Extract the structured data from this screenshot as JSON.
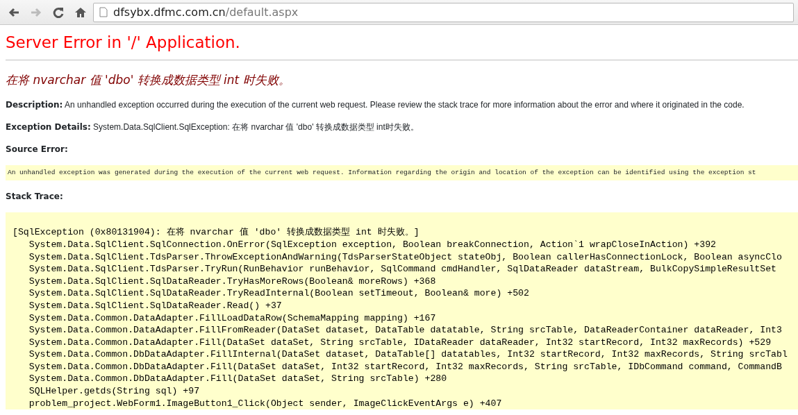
{
  "browser": {
    "nav_buttons": [
      {
        "kind": "back",
        "disabled": false
      },
      {
        "kind": "forward",
        "disabled": true
      },
      {
        "kind": "reload",
        "disabled": false
      },
      {
        "kind": "home",
        "disabled": false
      }
    ],
    "address": {
      "host": "dfsybx.dfmc.com.cn",
      "path": "/default.aspx"
    }
  },
  "page": {
    "title": "Server Error in '/' Application.",
    "error_message": "在将 nvarchar 值 'dbo' 转换成数据类型 int 时失败。",
    "description": "**Description:** An unhandled exception occurred during the execution of the current web request. Please review the stack trace for more information about the error and where it originated in the code.",
    "exception_details": "**Exception Details:** System.Data.SqlClient.SqlException: 在将 nvarchar 值 'dbo' 转换成数据类型 int时失败。",
    "source_error_heading": "Source Error:",
    "source_error_text": "An unhandled exception was generated during the execution of the current web request. Information regarding the origin and location of the exception can be identified using the exception st",
    "stack_trace_heading": "Stack Trace:",
    "stack_trace": [
      "[SqlException (0x80131904): 在将 nvarchar 值 'dbo' 转换成数据类型 int 时失败。]",
      "   System.Data.SqlClient.SqlConnection.OnError(SqlException exception, Boolean breakConnection, Action`1 wrapCloseInAction) +392",
      "   System.Data.SqlClient.TdsParser.ThrowExceptionAndWarning(TdsParserStateObject stateObj, Boolean callerHasConnectionLock, Boolean asyncClo",
      "   System.Data.SqlClient.TdsParser.TryRun(RunBehavior runBehavior, SqlCommand cmdHandler, SqlDataReader dataStream, BulkCopySimpleResultSet",
      "   System.Data.SqlClient.SqlDataReader.TryHasMoreRows(Boolean& moreRows) +368",
      "   System.Data.SqlClient.SqlDataReader.TryReadInternal(Boolean setTimeout, Boolean& more) +502",
      "   System.Data.SqlClient.SqlDataReader.Read() +37",
      "   System.Data.Common.DataAdapter.FillLoadDataRow(SchemaMapping mapping) +167",
      "   System.Data.Common.DataAdapter.FillFromReader(DataSet dataset, DataTable datatable, String srcTable, DataReaderContainer dataReader, Int3",
      "   System.Data.Common.DataAdapter.Fill(DataSet dataSet, String srcTable, IDataReader dataReader, Int32 startRecord, Int32 maxRecords) +529",
      "   System.Data.Common.DbDataAdapter.FillInternal(DataSet dataset, DataTable[] datatables, Int32 startRecord, Int32 maxRecords, String srcTabl",
      "   System.Data.Common.DbDataAdapter.Fill(DataSet dataSet, Int32 startRecord, Int32 maxRecords, String srcTable, IDbCommand command, CommandB",
      "   System.Data.Common.DbDataAdapter.Fill(DataSet dataSet, String srcTable) +280",
      "   SQLHelper.getds(String sql) +97",
      "   problem_project.WebForm1.ImageButton1_Click(Object sender, ImageClickEventArgs e) +407"
    ]
  }
}
